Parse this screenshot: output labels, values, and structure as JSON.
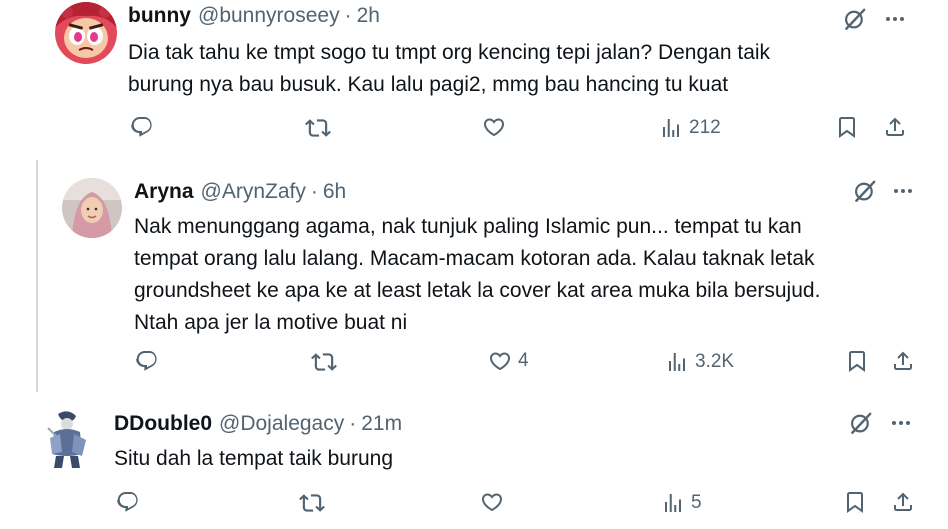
{
  "tweets": [
    {
      "name": "bunny",
      "handle": "@bunnyroseey",
      "separator": "·",
      "time": "2h",
      "lines": [
        "Dia tak tahu ke tmpt sogo tu tmpt org kencing tepi jalan? Dengan taik",
        "burung nya bau busuk. Kau lalu pagi2, mmg bau hancing tu kuat"
      ],
      "likes": "",
      "views": "212"
    },
    {
      "name": "Aryna",
      "handle": "@ArynZafy",
      "separator": "·",
      "time": "6h",
      "lines": [
        "Nak menunggang agama, nak tunjuk paling Islamic pun... tempat tu kan",
        "tempat orang lalu lalang. Macam-macam kotoran ada. Kalau taknak letak",
        "groundsheet ke apa ke at least letak la cover kat area muka bila bersujud.",
        "Ntah apa jer la motive buat ni"
      ],
      "likes": "4",
      "views": "3.2K"
    },
    {
      "name": "DDouble0",
      "handle": "@Dojalegacy",
      "separator": "·",
      "time": "21m",
      "lines": [
        "Situ dah la tempat taik burung"
      ],
      "likes": "",
      "views": "5"
    }
  ],
  "icons": {
    "grok": "grok-slash-icon",
    "more": "more-dots-icon",
    "reply": "reply-icon",
    "retweet": "retweet-icon",
    "like": "like-heart-icon",
    "views": "views-bars-icon",
    "bookmark": "bookmark-icon",
    "share": "share-icon"
  },
  "colors": {
    "text": "#0f1419",
    "secondary": "#536471",
    "thread_line": "#cfd9de"
  }
}
